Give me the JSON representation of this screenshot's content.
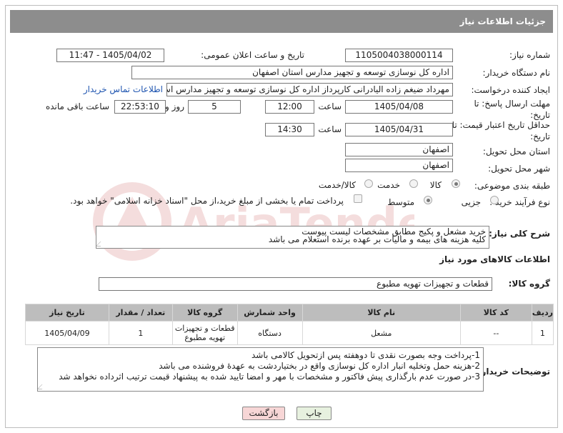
{
  "header": {
    "title": "جزئیات اطلاعات نیاز"
  },
  "fields": {
    "need_number_label": "شماره نیاز:",
    "need_number": "1105004038000114",
    "announce_label": "تاریخ و ساعت اعلان عمومی:",
    "announce_value": "1405/04/02 - 11:47",
    "buyer_org_label": "نام دستگاه خریدار:",
    "buyer_org": "اداره کل نوسازی  توسعه و تجهیز مدارس استان اصفهان",
    "creator_label": "ایجاد کننده درخواست:",
    "creator": "مهرداد ضیغم زاده الیادرانی کارپرداز اداره کل نوسازی  توسعه و تجهیز مدارس اس",
    "contact_link": "اطلاعات تماس خریدار",
    "reply_deadline_label": "مهلت ارسال پاسخ: تا تاریخ:",
    "reply_date": "1405/04/08",
    "time_label": "ساعت",
    "reply_time": "12:00",
    "days_value": "5",
    "days_label": "روز و",
    "remaining_time": "22:53:10",
    "remaining_label": "ساعت باقی مانده",
    "price_deadline_label": "حداقل تاریخ اعتبار قیمت: تا تاریخ:",
    "price_date": "1405/04/31",
    "price_time": "14:30",
    "province_label": "استان محل تحویل:",
    "province": "اصفهان",
    "city_label": "شهر محل تحویل:",
    "city": "اصفهان",
    "category_label": "طبقه بندی موضوعی:",
    "category_options": [
      "کالا",
      "خدمت",
      "کالا/خدمت"
    ],
    "purchase_label": "نوع فرآیند خرید :",
    "purchase_options": [
      "جزیی",
      "متوسط"
    ],
    "payment_text": "پرداخت تمام یا بخشی از مبلغ خرید،از محل \"اسناد خزانه اسلامی\" خواهد بود."
  },
  "description": {
    "label": "شرح کلی نیاز:",
    "lines": [
      "خرید مشعل و پکیج مطابق مشخصات لیست پیوست",
      "کلیه هزینه های بیمه و مالیات بر عهده برنده استعلام می باشد"
    ]
  },
  "goods": {
    "section_title": "اطلاعات کالاهای مورد نیاز",
    "group_label": "گروه کالا:",
    "group_value": "قطعات و تجهیزات تهویه مطبوع",
    "columns": [
      "ردیف",
      "کد کالا",
      "نام کالا",
      "واحد شمارش",
      "گروه کالا",
      "تعداد / مقدار",
      "تاریخ نیاز"
    ],
    "rows": [
      {
        "row": "1",
        "code": "--",
        "name": "مشعل",
        "unit": "دستگاه",
        "group_line1": "قطعات و تجهیزات",
        "group_line2": "تهویه مطبوع",
        "qty": "1",
        "date": "1405/04/09"
      }
    ]
  },
  "buyer_notes": {
    "label": "توضیحات خریدار:",
    "lines": [
      "1-پرداخت وجه بصورت نقدی تا دوهفته پس ازتحویل کالامی باشد",
      "2-هزینه حمل وتخلیه انبار اداره کل نوسازی واقع در بختیاردشت به عهدۀ فروشنده می باشد",
      "3-در صورت عدم بارگذاری پیش فاکتور و مشخصات با مهر و امضا تایید شده به پیشنهاد قیمت ترتیب اثرداده نخواهد شد"
    ]
  },
  "buttons": {
    "print": "چاپ",
    "back": "بازگشت"
  },
  "watermark": {
    "text": "AriaTender.net"
  },
  "colors": {
    "header_bg": "#8d8d8d",
    "link": "#1f55b0",
    "back_btn": "#f7d6d6",
    "print_btn": "#e7f1df",
    "table_header": "#bdbdbd"
  }
}
